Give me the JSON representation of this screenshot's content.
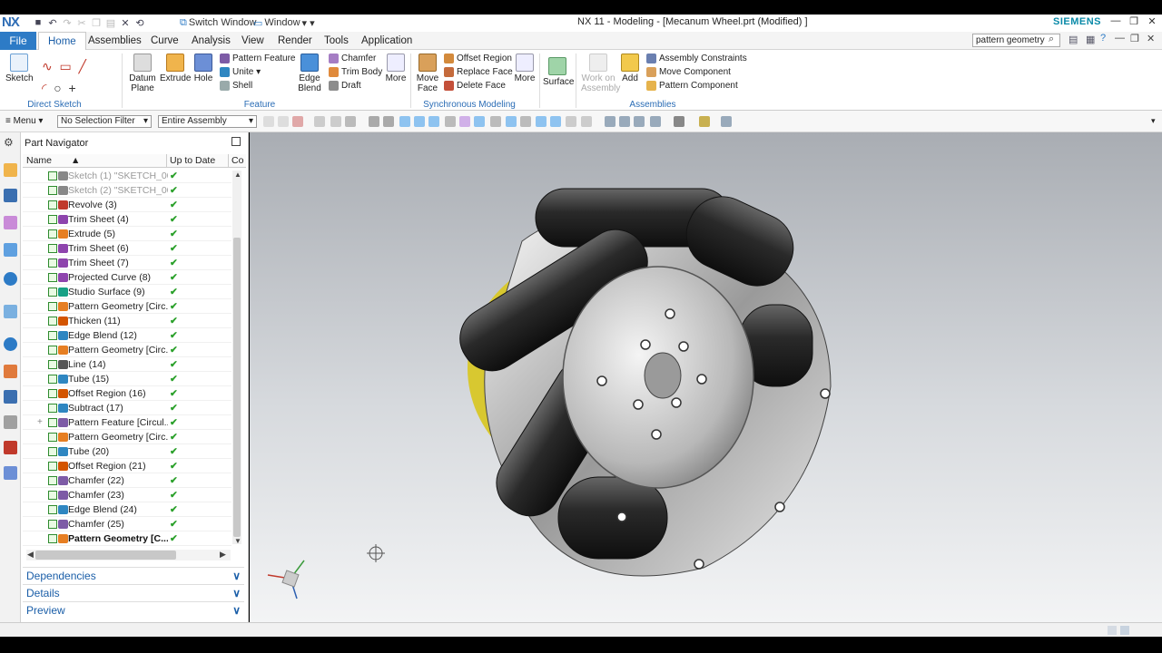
{
  "app": {
    "logo": "NX",
    "title": "NX 11 - Modeling - [Mecanum Wheel.prt (Modified) ]",
    "brand": "SIEMENS",
    "switch_window": "Switch Window",
    "window_menu": "Window"
  },
  "menu": {
    "file": "File",
    "tabs": [
      "Home",
      "Assemblies",
      "Curve",
      "Analysis",
      "View",
      "Render",
      "Tools",
      "Application"
    ],
    "search_value": "pattern geometry"
  },
  "ribbon": {
    "direct_sketch": {
      "label": "Direct Sketch",
      "sketch": "Sketch"
    },
    "feature": {
      "label": "Feature",
      "datum": "Datum Plane",
      "extrude": "Extrude",
      "hole": "Hole",
      "pattern_feature": "Pattern Feature",
      "unite": "Unite",
      "shell": "Shell",
      "edge_blend": "Edge Blend",
      "chamfer": "Chamfer",
      "trim_body": "Trim Body",
      "draft": "Draft",
      "more": "More"
    },
    "sync": {
      "label": "Synchronous Modeling",
      "move_face": "Move Face",
      "offset_region": "Offset Region",
      "replace_face": "Replace Face",
      "delete_face": "Delete Face",
      "more": "More"
    },
    "surface": {
      "label": "Surface"
    },
    "assemblies": {
      "label": "Assemblies",
      "work_on": "Work on Assembly",
      "add": "Add",
      "constraints": "Assembly Constraints",
      "move_component": "Move Component",
      "pattern_component": "Pattern Component"
    }
  },
  "toolbar": {
    "menu": "Menu",
    "filter": "No Selection Filter",
    "scope": "Entire Assembly"
  },
  "navigator": {
    "title": "Part Navigator",
    "columns": {
      "name": "Name",
      "uptodate": "Up to Date",
      "co": "Co"
    },
    "rows": [
      {
        "name": "Sketch (1) \"SKETCH_00...",
        "color": "#888888",
        "style": "grey"
      },
      {
        "name": "Sketch (2) \"SKETCH_00...",
        "color": "#888888",
        "style": "grey"
      },
      {
        "name": "Revolve (3)",
        "color": "#c0392b",
        "style": ""
      },
      {
        "name": "Trim Sheet (4)",
        "color": "#8e44ad",
        "style": ""
      },
      {
        "name": "Extrude (5)",
        "color": "#e67e22",
        "style": ""
      },
      {
        "name": "Trim Sheet (6)",
        "color": "#8e44ad",
        "style": ""
      },
      {
        "name": "Trim Sheet (7)",
        "color": "#8e44ad",
        "style": ""
      },
      {
        "name": "Projected Curve (8)",
        "color": "#8e44ad",
        "style": ""
      },
      {
        "name": "Studio Surface (9)",
        "color": "#16a085",
        "style": ""
      },
      {
        "name": "Pattern Geometry [Circ...",
        "color": "#e67e22",
        "style": ""
      },
      {
        "name": "Thicken (11)",
        "color": "#d35400",
        "style": ""
      },
      {
        "name": "Edge Blend (12)",
        "color": "#2e86c1",
        "style": ""
      },
      {
        "name": "Pattern Geometry [Circ...",
        "color": "#e67e22",
        "style": ""
      },
      {
        "name": "Line (14)",
        "color": "#555555",
        "style": ""
      },
      {
        "name": "Tube (15)",
        "color": "#2e86c1",
        "style": ""
      },
      {
        "name": "Offset Region (16)",
        "color": "#d35400",
        "style": ""
      },
      {
        "name": "Subtract (17)",
        "color": "#2e86c1",
        "style": ""
      },
      {
        "name": "Pattern Feature [Circul...",
        "color": "#7d5ba6",
        "style": "",
        "expand": true
      },
      {
        "name": "Pattern Geometry [Circ...",
        "color": "#e67e22",
        "style": ""
      },
      {
        "name": "Tube (20)",
        "color": "#2e86c1",
        "style": ""
      },
      {
        "name": "Offset Region (21)",
        "color": "#d35400",
        "style": ""
      },
      {
        "name": "Chamfer (22)",
        "color": "#7d5ba6",
        "style": ""
      },
      {
        "name": "Chamfer (23)",
        "color": "#7d5ba6",
        "style": ""
      },
      {
        "name": "Edge Blend (24)",
        "color": "#2e86c1",
        "style": ""
      },
      {
        "name": "Chamfer (25)",
        "color": "#7d5ba6",
        "style": ""
      },
      {
        "name": "Pattern Geometry [C...",
        "color": "#e67e22",
        "style": "bold"
      }
    ],
    "panels": [
      "Dependencies",
      "Details",
      "Preview"
    ]
  },
  "colors": {
    "accent": "#2d7bc6",
    "check": "#2aa02a",
    "roller": "#2a2a2a",
    "hub": "#c4c4c4",
    "yellow": "#e8d020"
  }
}
